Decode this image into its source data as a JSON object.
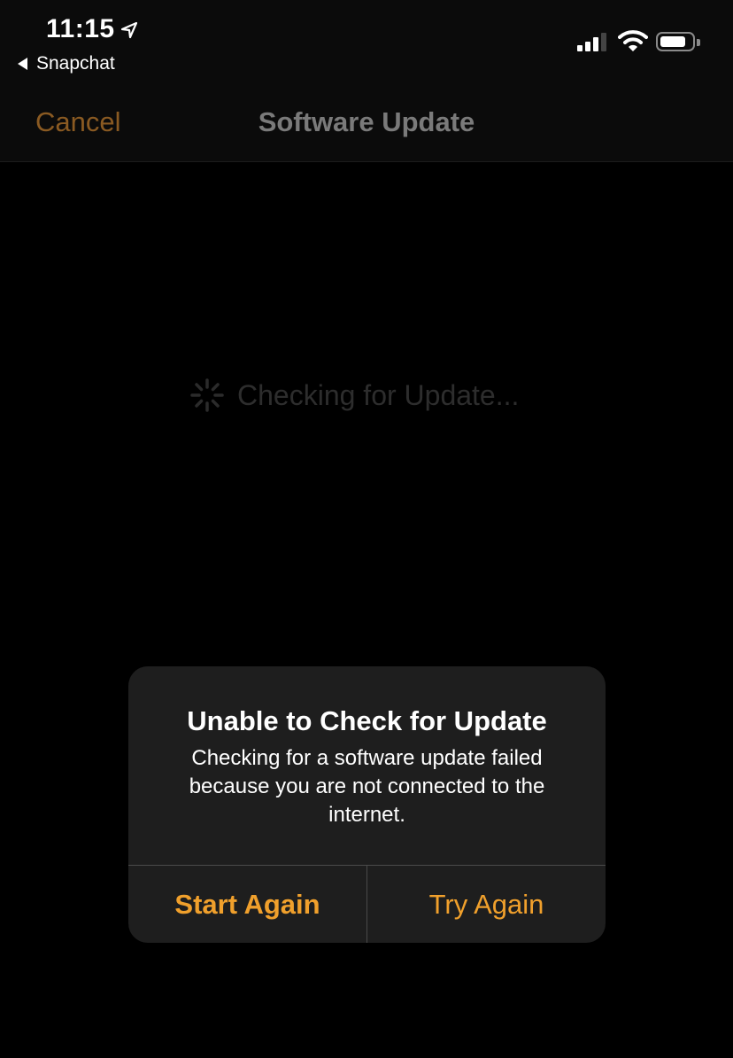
{
  "status_bar": {
    "time": "11:15",
    "back_app": "Snapchat",
    "icons": [
      "location-arrow-icon",
      "cellular-signal-icon",
      "wifi-icon",
      "battery-icon"
    ]
  },
  "nav": {
    "cancel_label": "Cancel",
    "title": "Software Update"
  },
  "main": {
    "status_text": "Checking for Update..."
  },
  "alert": {
    "title": "Unable to Check for Update",
    "message": "Checking for a software update failed because you are not connected to the internet.",
    "buttons": [
      {
        "label": "Start Again"
      },
      {
        "label": "Try Again"
      }
    ]
  },
  "colors": {
    "accent": "#f0a02c",
    "alert_bg": "#1e1e1e",
    "background": "#000000"
  }
}
